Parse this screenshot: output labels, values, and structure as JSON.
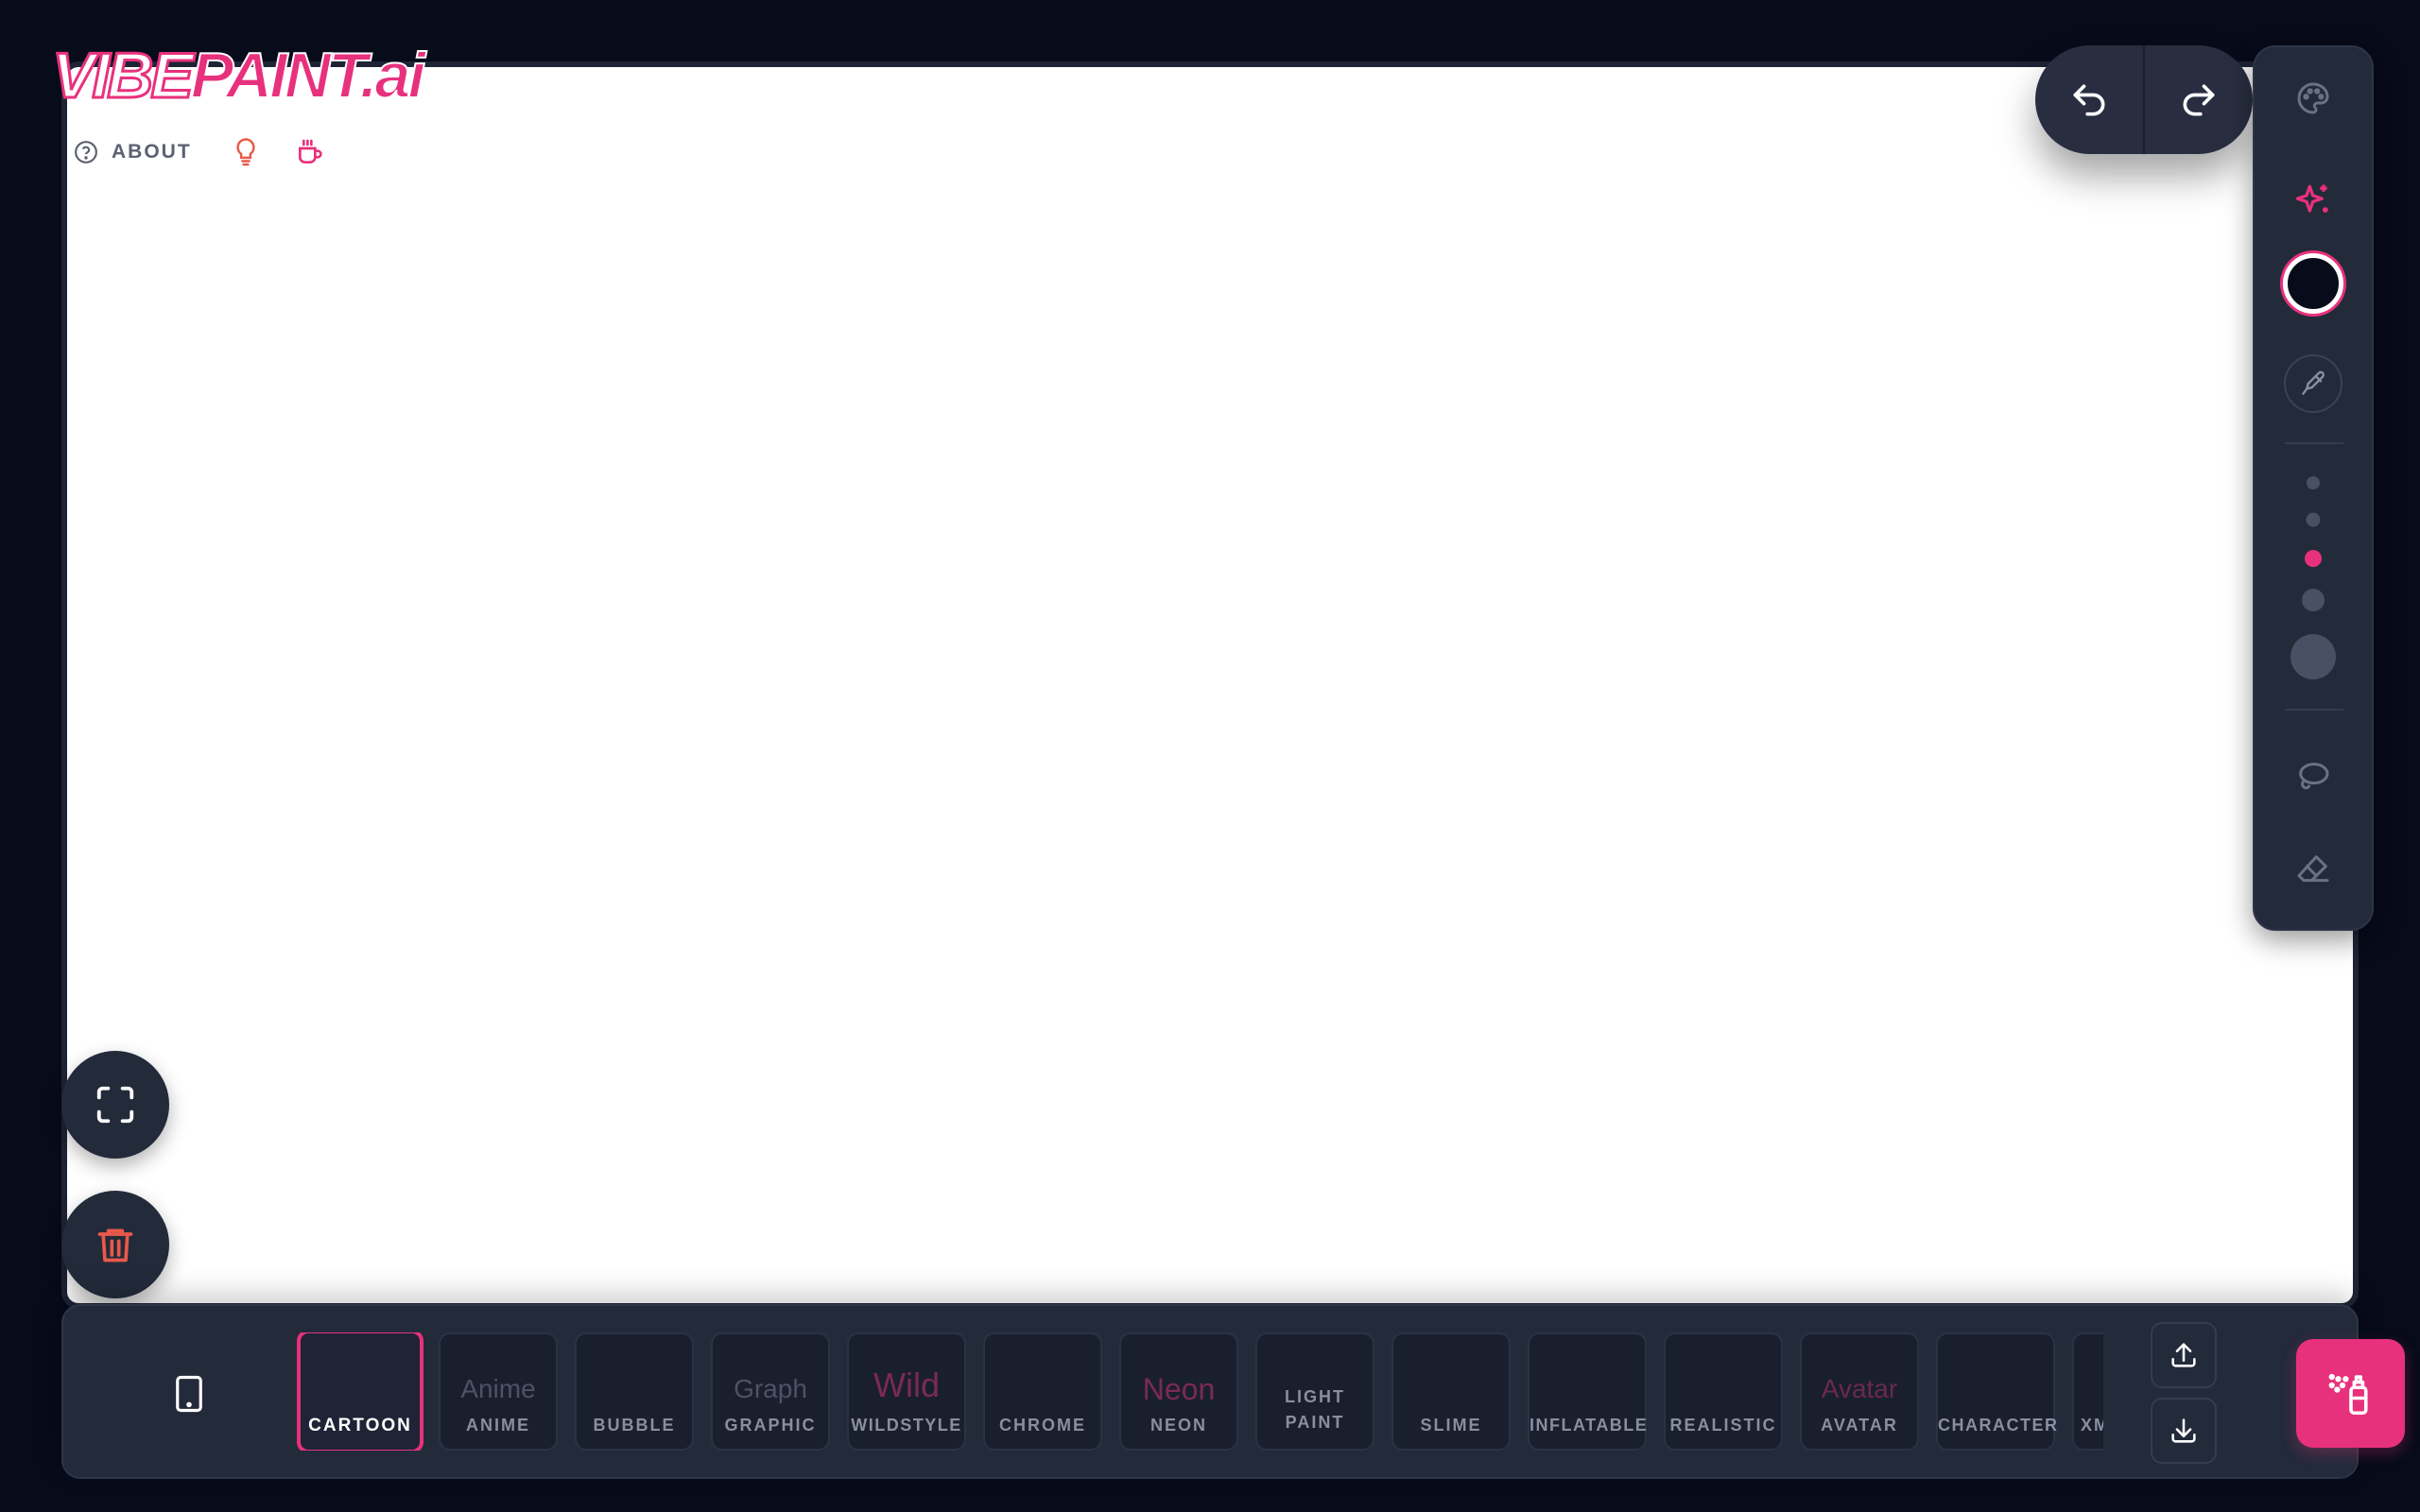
{
  "app": {
    "logo_vibe": "VIBE",
    "logo_paint": "PAINT",
    "logo_ai": ".ai",
    "about_label": "ABOUT",
    "brand_color": "#e8317d"
  },
  "toolbar": {
    "undo_icon": "undo-icon",
    "redo_icon": "redo-icon"
  },
  "sidebar": {
    "selected_color": "#070b1a",
    "brush_sizes": [
      "xs",
      "s",
      "m",
      "l",
      "xl"
    ],
    "active_brush_size": "m",
    "items": [
      "palette-icon",
      "sparkle-icon",
      "color-swatch",
      "eyedropper-icon",
      "lasso-icon",
      "eraser-icon"
    ]
  },
  "styles": [
    {
      "label": "CARTOON",
      "preview": "",
      "preview_color": "",
      "selected": true
    },
    {
      "label": "ANIME",
      "preview": "Anime",
      "preview_color": "#4d5265"
    },
    {
      "label": "BUBBLE",
      "preview": "",
      "preview_color": ""
    },
    {
      "label": "GRAPHIC",
      "preview": "Graph",
      "preview_color": "#4d5265"
    },
    {
      "label": "WILDSTYLE",
      "preview": "Wild",
      "preview_color": "#7a2a55"
    },
    {
      "label": "CHROME",
      "preview": "",
      "preview_color": ""
    },
    {
      "label": "NEON",
      "preview": "Neon",
      "preview_color": "#7a2a55"
    },
    {
      "label": "LIGHT PAINT",
      "preview": "",
      "preview_color": ""
    },
    {
      "label": "SLIME",
      "preview": "",
      "preview_color": ""
    },
    {
      "label": "INFLATABLE",
      "preview": "",
      "preview_color": ""
    },
    {
      "label": "REALISTIC",
      "preview": "",
      "preview_color": ""
    },
    {
      "label": "AVATAR",
      "preview": "Avatar",
      "preview_color": "#6a2a4d"
    },
    {
      "label": "CHARACTER",
      "preview": "",
      "preview_color": ""
    },
    {
      "label": "XMAS TEX",
      "preview": "",
      "preview_color": ""
    }
  ]
}
